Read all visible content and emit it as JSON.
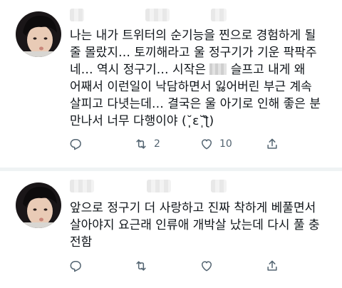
{
  "tweets": [
    {
      "lines": [
        "나는 내가 트위터의 순기능을 찐으로 경험하게 될",
        "줄 몰랐지… 토끼해라고 울 정구기가 기운 팍팍주",
        "네… 역시 정구기… 시작은",
        "슬프고 내게 왜",
        "어째서 이런일이 낙담하면서 잃어버린 부근 계속",
        "살피고 다녓는데… 결국은 울 아기로 인해 좋은 분",
        "만나서 너무 다행이야 (˘̩̩̩ε˘̩ƪ)"
      ],
      "reply_count": "",
      "retweet_count": "2",
      "like_count": "10"
    },
    {
      "lines": [
        "앞으로 정구기 더 사랑하고 진짜 착하게 베풀면서",
        "살아야지 요근래 인류애 개박살 났는데 다시 풀 충",
        "전함"
      ],
      "reply_count": "",
      "retweet_count": "",
      "like_count": ""
    }
  ],
  "icons": {
    "reply": "reply-icon",
    "retweet": "retweet-icon",
    "like": "heart-icon",
    "share": "share-icon"
  },
  "colors": {
    "text": "#0f1419",
    "icon": "#536471",
    "divider": "#eff3f4"
  }
}
